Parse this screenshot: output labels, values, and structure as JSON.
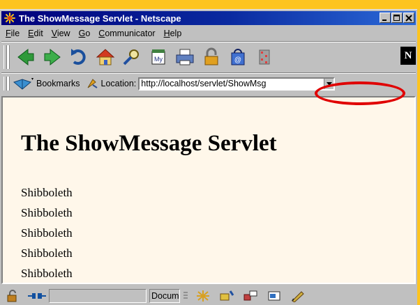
{
  "window": {
    "title": "The ShowMessage Servlet - Netscape",
    "controls": [
      "minimize",
      "maximize",
      "close"
    ]
  },
  "menubar": {
    "items": [
      {
        "label": "File",
        "mnemonic": "F",
        "rest": "ile"
      },
      {
        "label": "Edit",
        "mnemonic": "E",
        "rest": "dit"
      },
      {
        "label": "View",
        "mnemonic": "V",
        "rest": "iew"
      },
      {
        "label": "Go",
        "mnemonic": "G",
        "rest": "o"
      },
      {
        "label": "Communicator",
        "mnemonic": "C",
        "rest": "ommunicator"
      },
      {
        "label": "Help",
        "mnemonic": "H",
        "rest": "elp"
      }
    ]
  },
  "navbar": {
    "buttons": [
      "back-icon",
      "forward-icon",
      "reload-icon",
      "home-icon",
      "search-icon",
      "my-netscape-icon",
      "print-icon",
      "security-icon",
      "shop-icon",
      "stop-icon"
    ],
    "brand": "N"
  },
  "locationbar": {
    "bookmarks_label": "Bookmarks",
    "location_label": "Location:",
    "url": "http://localhost/servlet/ShowMsg"
  },
  "content": {
    "heading": "The ShowMessage Servlet",
    "messages": [
      "Shibboleth",
      "Shibboleth",
      "Shibboleth",
      "Shibboleth",
      "Shibboleth"
    ]
  },
  "statusbar": {
    "doc_text": "Document: Done"
  },
  "colors": {
    "title_gradient_start": "#00007b",
    "title_gradient_end": "#2c6ad8",
    "page_background": "#fff7ea",
    "chrome": "#c0c0c0",
    "highlight": "#e00000",
    "frame": "#fdc420"
  }
}
